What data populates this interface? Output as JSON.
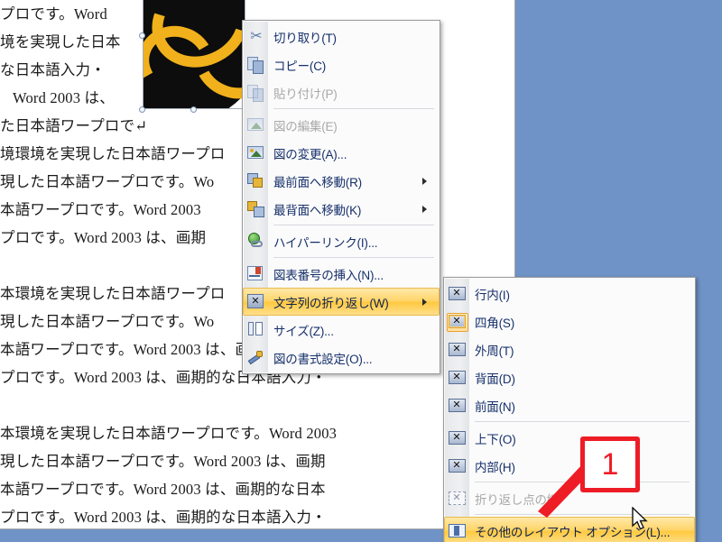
{
  "app": {
    "background_color": "#6f93c6",
    "page_color": "#ffffff"
  },
  "document": {
    "lines": [
      "プロです。Word",
      "境を実現した日本",
      "な日本語入力・",
      "  Word 2003 は、",
      "た日本語ワープロで↵",
      "境環境を実現した日本語ワープロ",
      "現した日本語ワープロです。Wo",
      "本語ワープロです。Word 2003",
      "プロです。Word 2003 は、画期",
      "",
      "本環境を実現した日本語ワープロ",
      "現した日本語ワープロです。Wo",
      "本語ワープロです。Word 2003 は、画期的な日本",
      "プロです。Word 2003 は、画期的な日本語入力・",
      "",
      "本環境を実現した日本語ワープロです。Word 2003",
      "現した日本語ワープロです。Word 2003 は、画期",
      "本語ワープロです。Word 2003 は、画期的な日本",
      "プロです。Word 2003 は、画期的な日本語入力・"
    ],
    "clipart": {
      "name": "clipart-image",
      "circle_color": "#0d0d0d",
      "swirl_color": "#f0b11c",
      "selected": true
    }
  },
  "context_menu": {
    "name": "picture-context-menu",
    "items": [
      {
        "label": "切り取り(T)",
        "icon": "scissors-icon",
        "disabled": false,
        "submenu": false,
        "highlighted": false,
        "sep_after": false
      },
      {
        "label": "コピー(C)",
        "icon": "copy-icon",
        "disabled": false,
        "submenu": false,
        "highlighted": false,
        "sep_after": false
      },
      {
        "label": "貼り付け(P)",
        "icon": "paste-icon",
        "disabled": true,
        "submenu": false,
        "highlighted": false,
        "sep_after": true
      },
      {
        "label": "図の編集(E)",
        "icon": "edit-picture-icon",
        "disabled": true,
        "submenu": false,
        "highlighted": false,
        "sep_after": false
      },
      {
        "label": "図の変更(A)...",
        "icon": "change-picture-icon",
        "disabled": false,
        "submenu": false,
        "highlighted": false,
        "sep_after": false
      },
      {
        "label": "最前面へ移動(R)",
        "icon": "bring-front-icon",
        "disabled": false,
        "submenu": true,
        "highlighted": false,
        "sep_after": false
      },
      {
        "label": "最背面へ移動(K)",
        "icon": "send-back-icon",
        "disabled": false,
        "submenu": true,
        "highlighted": false,
        "sep_after": true
      },
      {
        "label": "ハイパーリンク(I)...",
        "icon": "hyperlink-icon",
        "disabled": false,
        "submenu": false,
        "highlighted": false,
        "sep_after": true
      },
      {
        "label": "図表番号の挿入(N)...",
        "icon": "insert-caption-icon",
        "disabled": false,
        "submenu": false,
        "highlighted": false,
        "sep_after": false
      },
      {
        "label": "文字列の折り返し(W)",
        "icon": "text-wrapping-icon",
        "disabled": false,
        "submenu": true,
        "highlighted": true,
        "sep_after": false
      },
      {
        "label": "サイズ(Z)...",
        "icon": "size-icon",
        "disabled": false,
        "submenu": false,
        "highlighted": false,
        "sep_after": false
      },
      {
        "label": "図の書式設定(O)...",
        "icon": "format-picture-icon",
        "disabled": false,
        "submenu": false,
        "highlighted": false,
        "sep_after": false
      }
    ]
  },
  "wrap_submenu": {
    "name": "text-wrapping-submenu",
    "items": [
      {
        "label": "行内(I)",
        "icon": "wrap-inline-icon",
        "disabled": false,
        "selected": false,
        "highlighted": false,
        "sep_after": false
      },
      {
        "label": "四角(S)",
        "icon": "wrap-square-icon",
        "disabled": false,
        "selected": true,
        "highlighted": false,
        "sep_after": false
      },
      {
        "label": "外周(T)",
        "icon": "wrap-tight-icon",
        "disabled": false,
        "selected": false,
        "highlighted": false,
        "sep_after": false
      },
      {
        "label": "背面(D)",
        "icon": "wrap-behind-icon",
        "disabled": false,
        "selected": false,
        "highlighted": false,
        "sep_after": false
      },
      {
        "label": "前面(N)",
        "icon": "wrap-front-icon",
        "disabled": false,
        "selected": false,
        "highlighted": false,
        "sep_after": true
      },
      {
        "label": "上下(O)",
        "icon": "wrap-topbottom-icon",
        "disabled": false,
        "selected": false,
        "highlighted": false,
        "sep_after": false
      },
      {
        "label": "内部(H)",
        "icon": "wrap-through-icon",
        "disabled": false,
        "selected": false,
        "highlighted": false,
        "sep_after": true
      },
      {
        "label": "折り返し点の編",
        "icon": "edit-wrap-points-icon",
        "disabled": true,
        "selected": false,
        "highlighted": false,
        "sep_after": true
      },
      {
        "label": "その他のレイアウト オプション(L)...",
        "icon": "more-layout-options-icon",
        "disabled": false,
        "selected": false,
        "highlighted": true,
        "sep_after": false
      }
    ]
  },
  "annotation": {
    "name": "step-callout",
    "number": "1",
    "color": "#ee1c25"
  }
}
